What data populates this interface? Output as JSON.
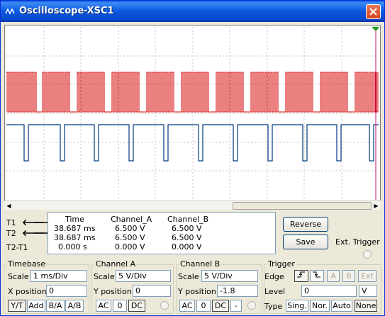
{
  "window": {
    "title": "Oscilloscope-XSC1"
  },
  "cursors": {
    "t1_label": "T1",
    "t2_label": "T2",
    "diff_label": "T2-T1"
  },
  "readout": {
    "headers": [
      "Time",
      "Channel_A",
      "Channel_B"
    ],
    "rows": [
      [
        "38.687 ms",
        "6.500 V",
        "6.500 V"
      ],
      [
        "38.687 ms",
        "6.500 V",
        "6.500 V"
      ],
      [
        "0.000 s",
        "0.000 V",
        "0.000 V"
      ]
    ]
  },
  "buttons": {
    "reverse": "Reverse",
    "save": "Save",
    "ext_trigger": "Ext. Trigger"
  },
  "timebase": {
    "title": "Timebase",
    "scale_label": "Scale",
    "scale_value": "1 ms/Div",
    "xpos_label": "X position",
    "xpos_value": "0",
    "modes": [
      "Y/T",
      "Add",
      "B/A",
      "A/B"
    ],
    "selected_mode": "Y/T"
  },
  "channel_a": {
    "title": "Channel A",
    "scale_label": "Scale",
    "scale_value": "5  V/Div",
    "ypos_label": "Y position",
    "ypos_value": "0",
    "coupling": [
      "AC",
      "0",
      "DC"
    ]
  },
  "channel_b": {
    "title": "Channel B",
    "scale_label": "Scale",
    "scale_value": "5  V/Div",
    "ypos_label": "Y position",
    "ypos_value": "-1.8",
    "coupling": [
      "AC",
      "0",
      "DC",
      "-"
    ]
  },
  "trigger": {
    "title": "Trigger",
    "edge_label": "Edge",
    "edge_sources": [
      "A",
      "B",
      "Ext"
    ],
    "level_label": "Level",
    "level_value": "0",
    "level_unit": "V",
    "type_label": "Type",
    "types": [
      "Sing.",
      "Nor.",
      "Auto",
      "None"
    ],
    "selected_type": "None"
  },
  "colors": {
    "channel_a": "#d40000",
    "channel_b": "#003a80",
    "grid": "#c0c0c0",
    "accent": "#0a5fdf"
  },
  "icons": {
    "app": "oscilloscope-icon",
    "close": "close-icon",
    "trigger_marker": "trigger-marker-icon"
  }
}
